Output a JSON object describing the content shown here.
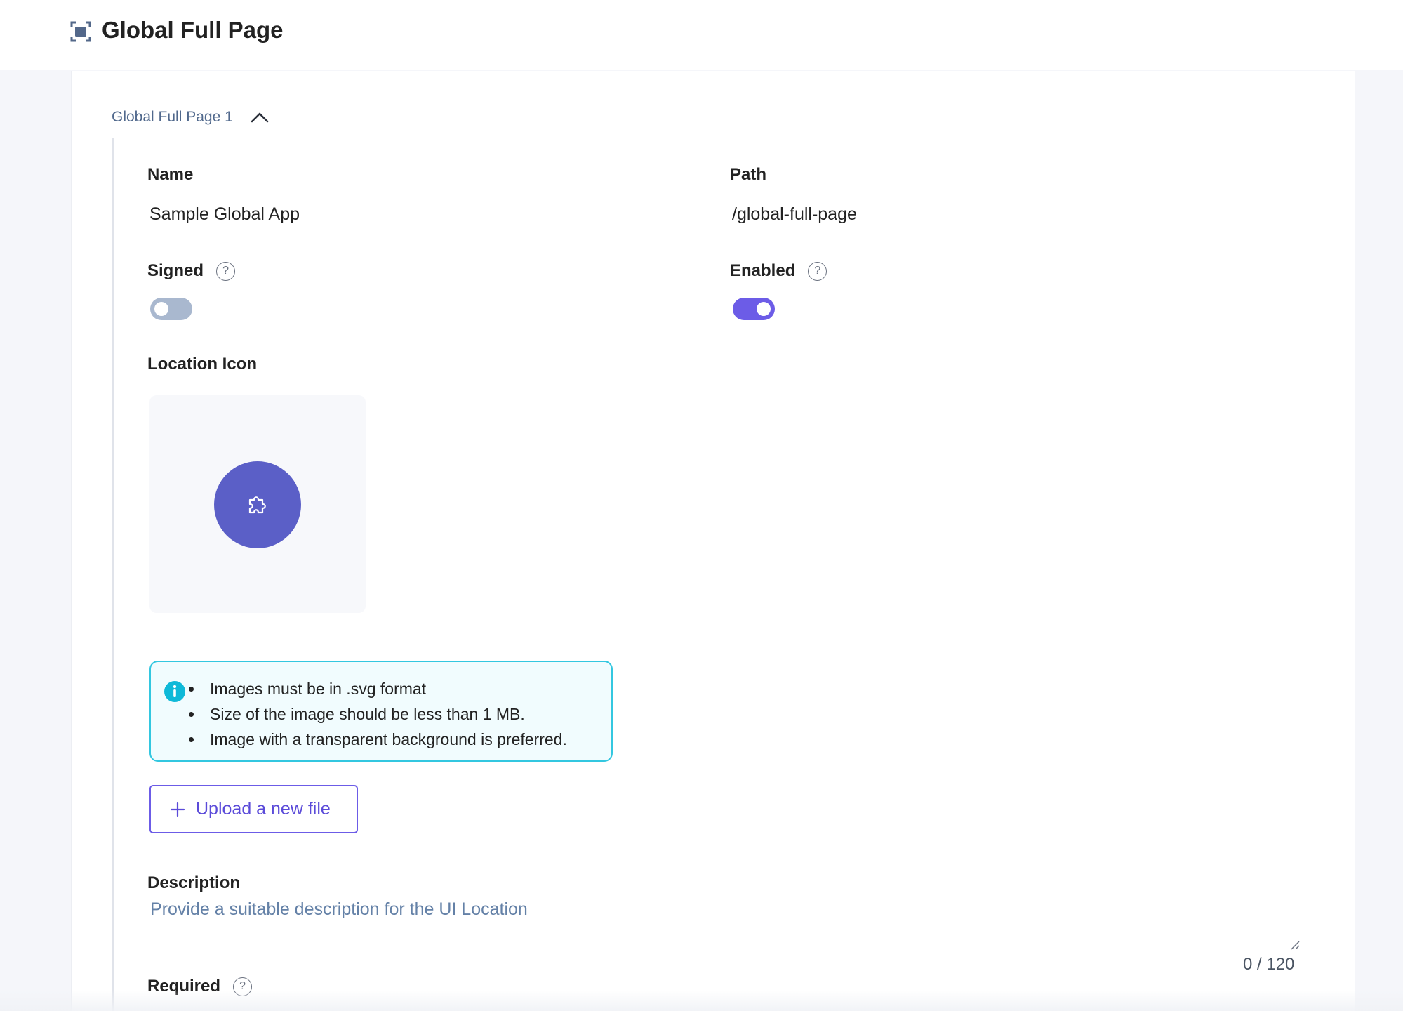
{
  "header": {
    "title": "Global Full Page",
    "icon": "full-page-icon"
  },
  "accordion": {
    "title": "Global Full Page 1",
    "expanded": true
  },
  "fields": {
    "name": {
      "label": "Name",
      "value": "Sample Global App"
    },
    "path": {
      "label": "Path",
      "value": "/global-full-page"
    },
    "signed": {
      "label": "Signed",
      "enabled": false
    },
    "enabled": {
      "label": "Enabled",
      "enabled": true
    },
    "location_icon": {
      "label": "Location Icon",
      "icon": "puzzle-icon"
    },
    "description": {
      "label": "Description",
      "placeholder": "Provide a suitable description for the UI Location",
      "char_count": "0 / 120"
    },
    "required": {
      "label": "Required"
    }
  },
  "info": {
    "items": [
      "Images must be in .svg format",
      "Size of the image should be less than 1 MB.",
      "Image with a transparent background is preferred."
    ]
  },
  "upload": {
    "label": "Upload a new file"
  },
  "colors": {
    "accent": "#6c5ce7",
    "toggle_off": "#a9b8cf",
    "icon_circle": "#5b5fc7",
    "info_border": "#33c7e0"
  }
}
